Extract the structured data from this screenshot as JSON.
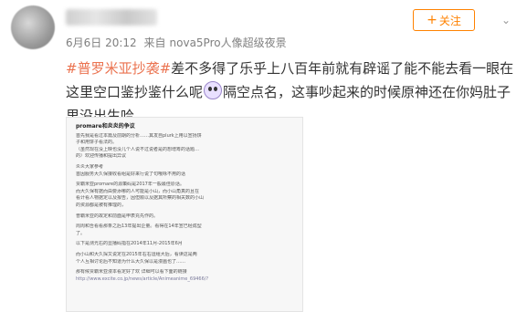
{
  "post": {
    "date": "6月6日 20:12",
    "source_prefix": "来自",
    "source_device": "nova5Pro人像超级夜景",
    "follow_label": "关注",
    "follow_plus": "+",
    "more_glyph": "⌄",
    "hashtag": "#普罗米亚抄袭#",
    "text_part1": "差不多得了乐乎上八百年前就有辟谣了能不能去看一眼在这里空口鉴抄鉴什么呢",
    "text_part2": "隔空点名，这事吵起来的时候原神还在你妈肚子里没出生哈"
  },
  "document": {
    "title": "promare和炎炎的争议",
    "lines": [
      "首先我是看过本篇及前期的分析……其发自plurk上用以宣扬饼",
      "子和用饼子看法的。",
      "（虽然现在没上映也没几个人说不过说者是的想增筹的话题…",
      "的）欢迎传播和提出异议",
      "",
      "炎炎大家参考",
      "首因服务大久保接收看组是好来行说了句哦咏不用的话",
      "",
      "贾霸米亚promare的源策码是2017年一般最佳原话。",
      "而大久保有据而由要添哪的人可能是小山，而小山角真的且在",
      "看计看人物据定以及报告，因但顺以及据其所察的相关数的小山",
      "的资源都是被有推理的，",
      "",
      "普霸米亚的故定和前面是申表充先作的。",
      "",
      "周周和吾看看那条之后13年提出企量。看得在14年宣已经成型",
      "了。",
      "",
      "以下是测光右的显播码指在2014年11月-2015年6月",
      "",
      "而小山和大久探又说定在2015年右右运组大后，看读这是两",
      "个人互相讨论后不知道为什么大久保以是漫画也了……",
      "",
      "那有候贾霸米亚漫本看定好了欢 详细可以看下面的链接"
    ],
    "link": "http://www.excite.co.jp/news/article/Animeanime_69466/?"
  }
}
